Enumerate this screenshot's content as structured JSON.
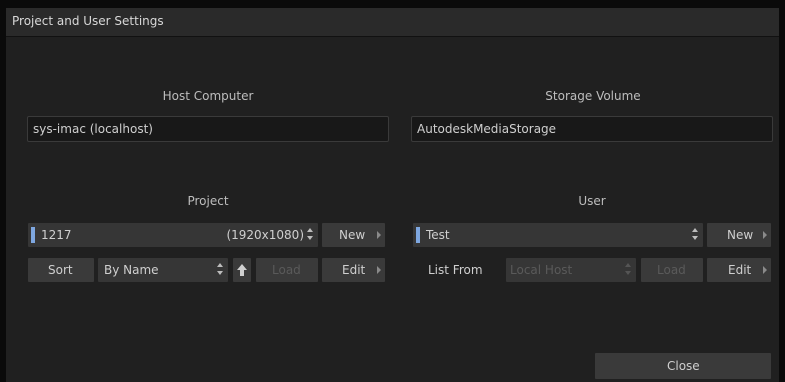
{
  "window": {
    "title": "Project and User Settings"
  },
  "host": {
    "label": "Host Computer",
    "value": "sys-imac (localhost)"
  },
  "storage": {
    "label": "Storage Volume",
    "value": "AutodeskMediaStorage"
  },
  "project": {
    "label": "Project",
    "name": "1217",
    "resolution": "(1920x1080)",
    "new_label": "New",
    "sort_label": "Sort",
    "sort_by": "By Name",
    "load_label": "Load",
    "edit_label": "Edit"
  },
  "user": {
    "label": "User",
    "name": "Test",
    "new_label": "New",
    "list_from_label": "List From",
    "list_from_value": "Local Host",
    "load_label": "Load",
    "edit_label": "Edit"
  },
  "footer": {
    "close_label": "Close"
  }
}
